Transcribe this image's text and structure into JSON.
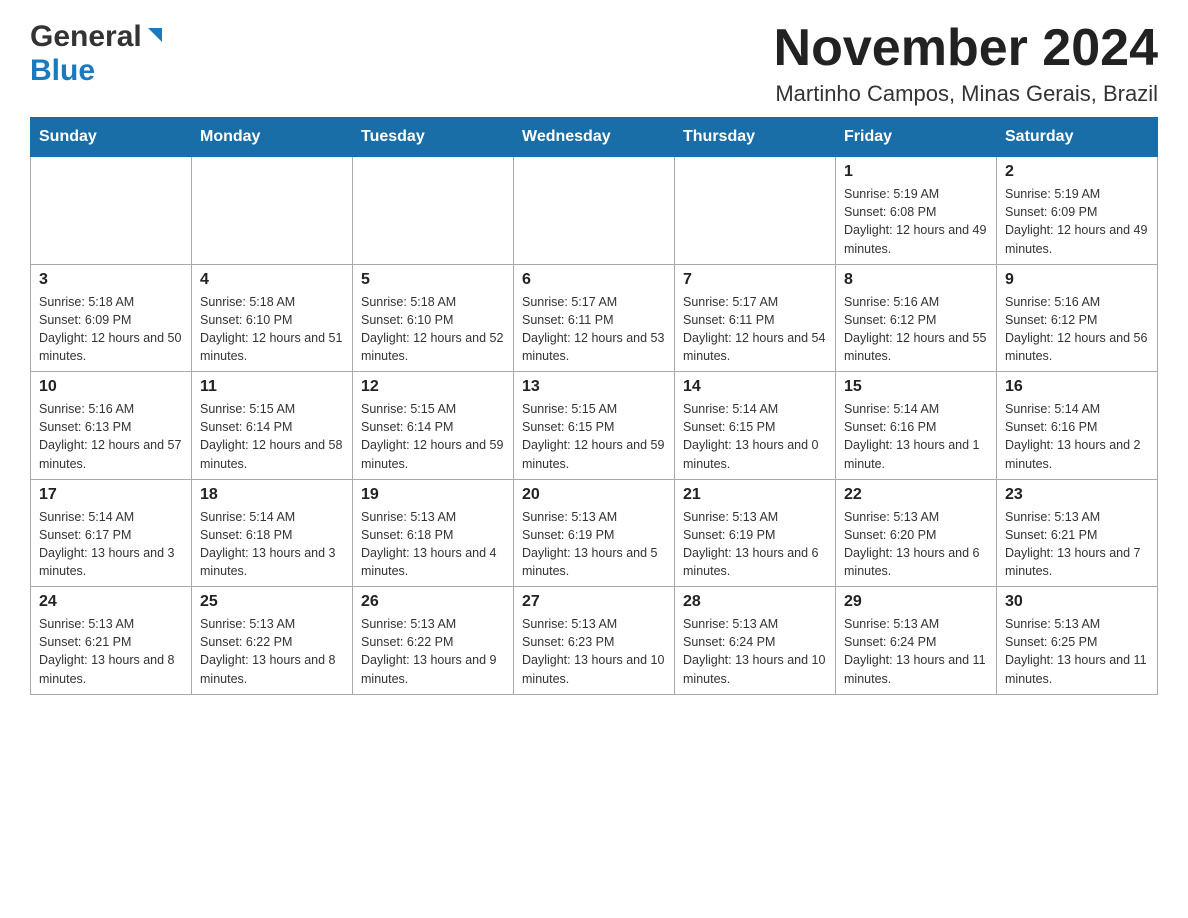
{
  "header": {
    "logo_general": "General",
    "logo_blue": "Blue",
    "month_title": "November 2024",
    "location": "Martinho Campos, Minas Gerais, Brazil"
  },
  "days_of_week": [
    "Sunday",
    "Monday",
    "Tuesday",
    "Wednesday",
    "Thursday",
    "Friday",
    "Saturday"
  ],
  "weeks": [
    [
      {
        "day": "",
        "sunrise": "",
        "sunset": "",
        "daylight": ""
      },
      {
        "day": "",
        "sunrise": "",
        "sunset": "",
        "daylight": ""
      },
      {
        "day": "",
        "sunrise": "",
        "sunset": "",
        "daylight": ""
      },
      {
        "day": "",
        "sunrise": "",
        "sunset": "",
        "daylight": ""
      },
      {
        "day": "",
        "sunrise": "",
        "sunset": "",
        "daylight": ""
      },
      {
        "day": "1",
        "sunrise": "Sunrise: 5:19 AM",
        "sunset": "Sunset: 6:08 PM",
        "daylight": "Daylight: 12 hours and 49 minutes."
      },
      {
        "day": "2",
        "sunrise": "Sunrise: 5:19 AM",
        "sunset": "Sunset: 6:09 PM",
        "daylight": "Daylight: 12 hours and 49 minutes."
      }
    ],
    [
      {
        "day": "3",
        "sunrise": "Sunrise: 5:18 AM",
        "sunset": "Sunset: 6:09 PM",
        "daylight": "Daylight: 12 hours and 50 minutes."
      },
      {
        "day": "4",
        "sunrise": "Sunrise: 5:18 AM",
        "sunset": "Sunset: 6:10 PM",
        "daylight": "Daylight: 12 hours and 51 minutes."
      },
      {
        "day": "5",
        "sunrise": "Sunrise: 5:18 AM",
        "sunset": "Sunset: 6:10 PM",
        "daylight": "Daylight: 12 hours and 52 minutes."
      },
      {
        "day": "6",
        "sunrise": "Sunrise: 5:17 AM",
        "sunset": "Sunset: 6:11 PM",
        "daylight": "Daylight: 12 hours and 53 minutes."
      },
      {
        "day": "7",
        "sunrise": "Sunrise: 5:17 AM",
        "sunset": "Sunset: 6:11 PM",
        "daylight": "Daylight: 12 hours and 54 minutes."
      },
      {
        "day": "8",
        "sunrise": "Sunrise: 5:16 AM",
        "sunset": "Sunset: 6:12 PM",
        "daylight": "Daylight: 12 hours and 55 minutes."
      },
      {
        "day": "9",
        "sunrise": "Sunrise: 5:16 AM",
        "sunset": "Sunset: 6:12 PM",
        "daylight": "Daylight: 12 hours and 56 minutes."
      }
    ],
    [
      {
        "day": "10",
        "sunrise": "Sunrise: 5:16 AM",
        "sunset": "Sunset: 6:13 PM",
        "daylight": "Daylight: 12 hours and 57 minutes."
      },
      {
        "day": "11",
        "sunrise": "Sunrise: 5:15 AM",
        "sunset": "Sunset: 6:14 PM",
        "daylight": "Daylight: 12 hours and 58 minutes."
      },
      {
        "day": "12",
        "sunrise": "Sunrise: 5:15 AM",
        "sunset": "Sunset: 6:14 PM",
        "daylight": "Daylight: 12 hours and 59 minutes."
      },
      {
        "day": "13",
        "sunrise": "Sunrise: 5:15 AM",
        "sunset": "Sunset: 6:15 PM",
        "daylight": "Daylight: 12 hours and 59 minutes."
      },
      {
        "day": "14",
        "sunrise": "Sunrise: 5:14 AM",
        "sunset": "Sunset: 6:15 PM",
        "daylight": "Daylight: 13 hours and 0 minutes."
      },
      {
        "day": "15",
        "sunrise": "Sunrise: 5:14 AM",
        "sunset": "Sunset: 6:16 PM",
        "daylight": "Daylight: 13 hours and 1 minute."
      },
      {
        "day": "16",
        "sunrise": "Sunrise: 5:14 AM",
        "sunset": "Sunset: 6:16 PM",
        "daylight": "Daylight: 13 hours and 2 minutes."
      }
    ],
    [
      {
        "day": "17",
        "sunrise": "Sunrise: 5:14 AM",
        "sunset": "Sunset: 6:17 PM",
        "daylight": "Daylight: 13 hours and 3 minutes."
      },
      {
        "day": "18",
        "sunrise": "Sunrise: 5:14 AM",
        "sunset": "Sunset: 6:18 PM",
        "daylight": "Daylight: 13 hours and 3 minutes."
      },
      {
        "day": "19",
        "sunrise": "Sunrise: 5:13 AM",
        "sunset": "Sunset: 6:18 PM",
        "daylight": "Daylight: 13 hours and 4 minutes."
      },
      {
        "day": "20",
        "sunrise": "Sunrise: 5:13 AM",
        "sunset": "Sunset: 6:19 PM",
        "daylight": "Daylight: 13 hours and 5 minutes."
      },
      {
        "day": "21",
        "sunrise": "Sunrise: 5:13 AM",
        "sunset": "Sunset: 6:19 PM",
        "daylight": "Daylight: 13 hours and 6 minutes."
      },
      {
        "day": "22",
        "sunrise": "Sunrise: 5:13 AM",
        "sunset": "Sunset: 6:20 PM",
        "daylight": "Daylight: 13 hours and 6 minutes."
      },
      {
        "day": "23",
        "sunrise": "Sunrise: 5:13 AM",
        "sunset": "Sunset: 6:21 PM",
        "daylight": "Daylight: 13 hours and 7 minutes."
      }
    ],
    [
      {
        "day": "24",
        "sunrise": "Sunrise: 5:13 AM",
        "sunset": "Sunset: 6:21 PM",
        "daylight": "Daylight: 13 hours and 8 minutes."
      },
      {
        "day": "25",
        "sunrise": "Sunrise: 5:13 AM",
        "sunset": "Sunset: 6:22 PM",
        "daylight": "Daylight: 13 hours and 8 minutes."
      },
      {
        "day": "26",
        "sunrise": "Sunrise: 5:13 AM",
        "sunset": "Sunset: 6:22 PM",
        "daylight": "Daylight: 13 hours and 9 minutes."
      },
      {
        "day": "27",
        "sunrise": "Sunrise: 5:13 AM",
        "sunset": "Sunset: 6:23 PM",
        "daylight": "Daylight: 13 hours and 10 minutes."
      },
      {
        "day": "28",
        "sunrise": "Sunrise: 5:13 AM",
        "sunset": "Sunset: 6:24 PM",
        "daylight": "Daylight: 13 hours and 10 minutes."
      },
      {
        "day": "29",
        "sunrise": "Sunrise: 5:13 AM",
        "sunset": "Sunset: 6:24 PM",
        "daylight": "Daylight: 13 hours and 11 minutes."
      },
      {
        "day": "30",
        "sunrise": "Sunrise: 5:13 AM",
        "sunset": "Sunset: 6:25 PM",
        "daylight": "Daylight: 13 hours and 11 minutes."
      }
    ]
  ]
}
